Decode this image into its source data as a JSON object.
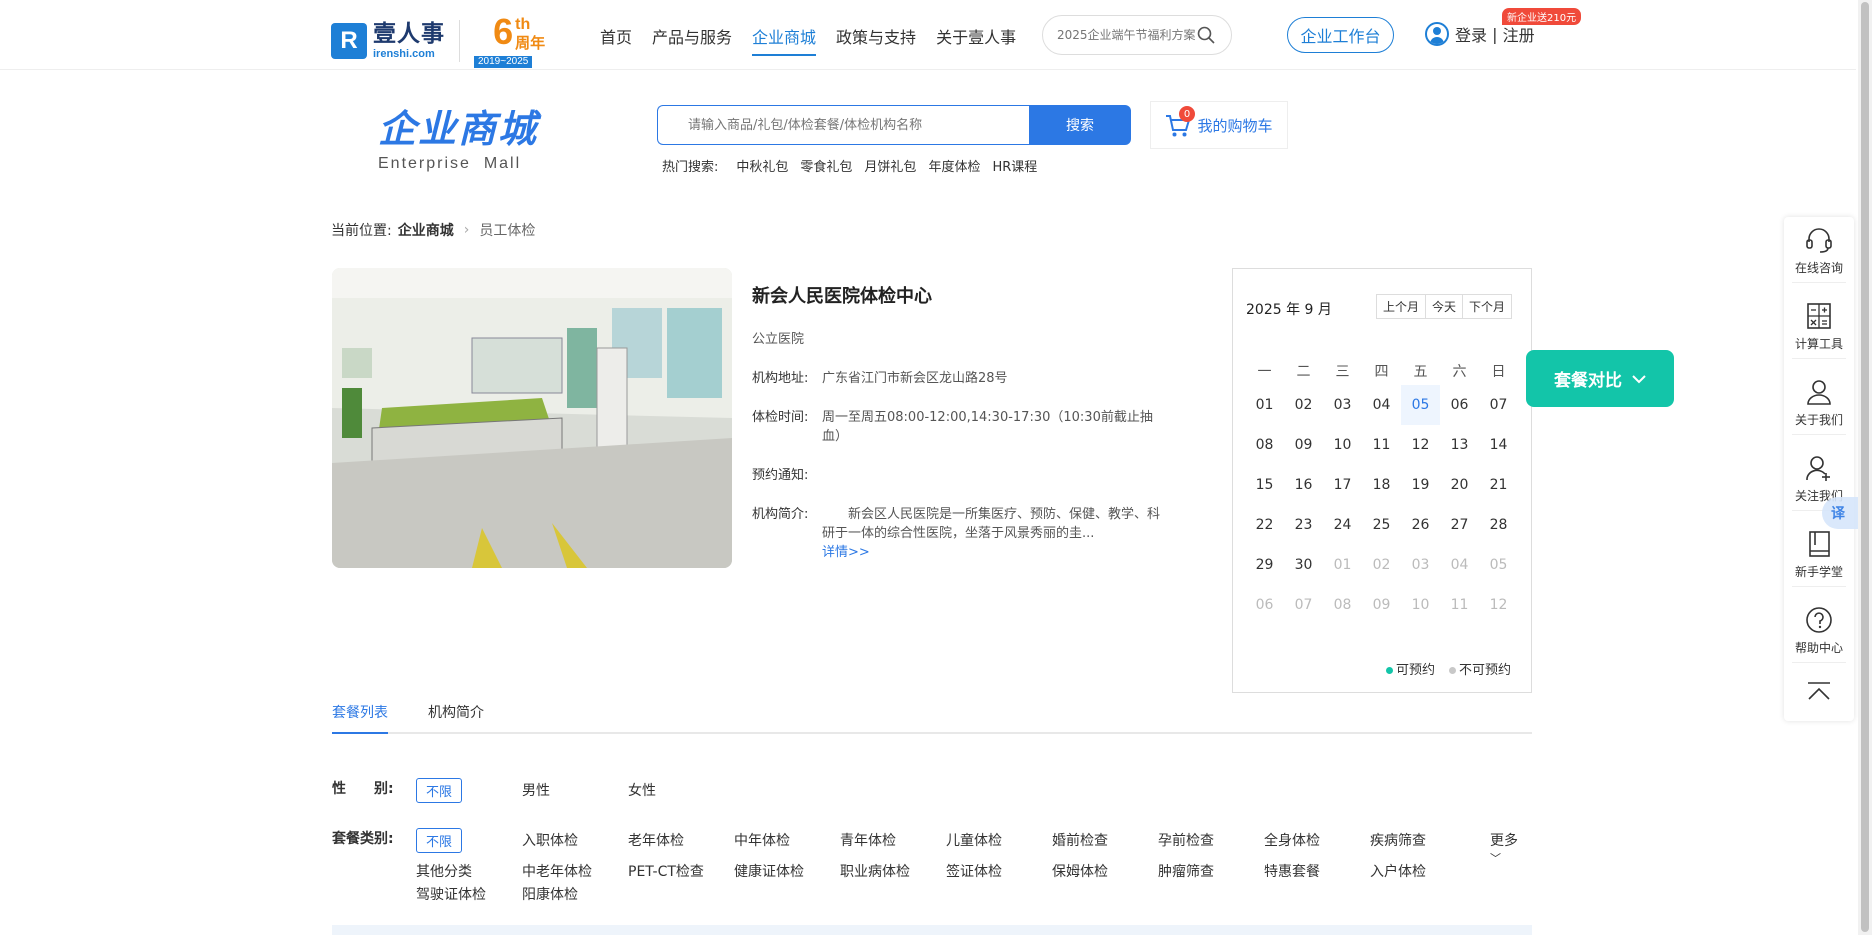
{
  "header": {
    "logo_cn": "壹人事",
    "logo_en": "irenshi.com",
    "anniversary_num": "6",
    "anniversary_sup": "th",
    "anniversary_word": "周年",
    "anniversary_years": "2019~2025",
    "nav": [
      "首页",
      "产品与服务",
      "企业商城",
      "政策与支持",
      "关于壹人事"
    ],
    "nav_active_index": 2,
    "search_placeholder": "2025企业端午节福利方案",
    "workbench": "企业工作台",
    "login": "登录",
    "login_sep": " | ",
    "register": "注册",
    "promo": "新企业送210元"
  },
  "mall": {
    "title_cn": "企业商城",
    "title_en": "Enterprise  Mall",
    "search_placeholder": "请输入商品/礼包/体检套餐/体检机构名称",
    "search_btn": "搜索",
    "hot_label": "热门搜索:",
    "hot": [
      "中秋礼包",
      "零食礼包",
      "月饼礼包",
      "年度体检",
      "HR课程"
    ],
    "cart_label": "我的购物车",
    "cart_count": "0"
  },
  "breadcrumb": {
    "prefix": "当前位置:",
    "level1": "企业商城",
    "current": "员工体检"
  },
  "institution": {
    "name": "新会人民医院体检中心",
    "type": "公立医院",
    "address_label": "机构地址:",
    "address": "广东省江门市新会区龙山路28号",
    "hours_label": "体检时间:",
    "hours": "周一至周五08:00-12:00,14:30-17:30（10:30前截止抽血）",
    "notice_label": "预约通知:",
    "notice": "",
    "intro_label": "机构简介:",
    "intro": "新会区人民医院是一所集医疗、预防、保健、教学、科研于一体的综合性医院，坐落于风景秀丽的圭...",
    "intro_more": "详情>>"
  },
  "calendar": {
    "title": "2025 年 9 月",
    "prev": "上个月",
    "today": "今天",
    "next": "下个月",
    "weekdays": [
      "一",
      "二",
      "三",
      "四",
      "五",
      "六",
      "日"
    ],
    "days": [
      {
        "d": "01",
        "m": "cur"
      },
      {
        "d": "02",
        "m": "cur"
      },
      {
        "d": "03",
        "m": "cur"
      },
      {
        "d": "04",
        "m": "cur"
      },
      {
        "d": "05",
        "m": "today"
      },
      {
        "d": "06",
        "m": "cur"
      },
      {
        "d": "07",
        "m": "cur"
      },
      {
        "d": "08",
        "m": "cur"
      },
      {
        "d": "09",
        "m": "cur"
      },
      {
        "d": "10",
        "m": "cur"
      },
      {
        "d": "11",
        "m": "cur"
      },
      {
        "d": "12",
        "m": "cur"
      },
      {
        "d": "13",
        "m": "cur"
      },
      {
        "d": "14",
        "m": "cur"
      },
      {
        "d": "15",
        "m": "cur"
      },
      {
        "d": "16",
        "m": "cur"
      },
      {
        "d": "17",
        "m": "cur"
      },
      {
        "d": "18",
        "m": "cur"
      },
      {
        "d": "19",
        "m": "cur"
      },
      {
        "d": "20",
        "m": "cur"
      },
      {
        "d": "21",
        "m": "cur"
      },
      {
        "d": "22",
        "m": "cur"
      },
      {
        "d": "23",
        "m": "cur"
      },
      {
        "d": "24",
        "m": "cur"
      },
      {
        "d": "25",
        "m": "cur"
      },
      {
        "d": "26",
        "m": "cur"
      },
      {
        "d": "27",
        "m": "cur"
      },
      {
        "d": "28",
        "m": "cur"
      },
      {
        "d": "29",
        "m": "cur"
      },
      {
        "d": "30",
        "m": "cur"
      },
      {
        "d": "01",
        "m": "other"
      },
      {
        "d": "02",
        "m": "other"
      },
      {
        "d": "03",
        "m": "other"
      },
      {
        "d": "04",
        "m": "other"
      },
      {
        "d": "05",
        "m": "other"
      },
      {
        "d": "06",
        "m": "other"
      },
      {
        "d": "07",
        "m": "other"
      },
      {
        "d": "08",
        "m": "other"
      },
      {
        "d": "09",
        "m": "other"
      },
      {
        "d": "10",
        "m": "other"
      },
      {
        "d": "11",
        "m": "other"
      },
      {
        "d": "12",
        "m": "other"
      }
    ],
    "legend_available": "可预约",
    "legend_unavailable": "不可预约",
    "available_color": "#13c5a9",
    "unavailable_color": "#c8c8c8"
  },
  "compare_btn": "套餐对比",
  "tabs": [
    "套餐列表",
    "机构简介"
  ],
  "filters": {
    "gender_label": "性　　别:",
    "gender_options": [
      "不限",
      "男性",
      "女性"
    ],
    "category_label": "套餐类别:",
    "category_selected": "不限",
    "category_row1": [
      "入职体检",
      "老年体检",
      "中年体检",
      "青年体检",
      "儿童体检",
      "婚前检查",
      "孕前检查",
      "全身体检",
      "疾病筛查"
    ],
    "category_row2": [
      "其他分类",
      "中老年体检",
      "PET-CT检查",
      "健康证体检",
      "职业病体检",
      "签证体检",
      "保姆体检",
      "肿瘤筛查",
      "特惠套餐",
      "入户体检"
    ],
    "category_row3": [
      "驾驶证体检",
      "阳康体检"
    ],
    "more": "更多"
  },
  "sidebar": [
    "在线咨询",
    "计算工具",
    "关于我们",
    "关注我们",
    "新手学堂",
    "帮助中心"
  ],
  "translate": "译"
}
